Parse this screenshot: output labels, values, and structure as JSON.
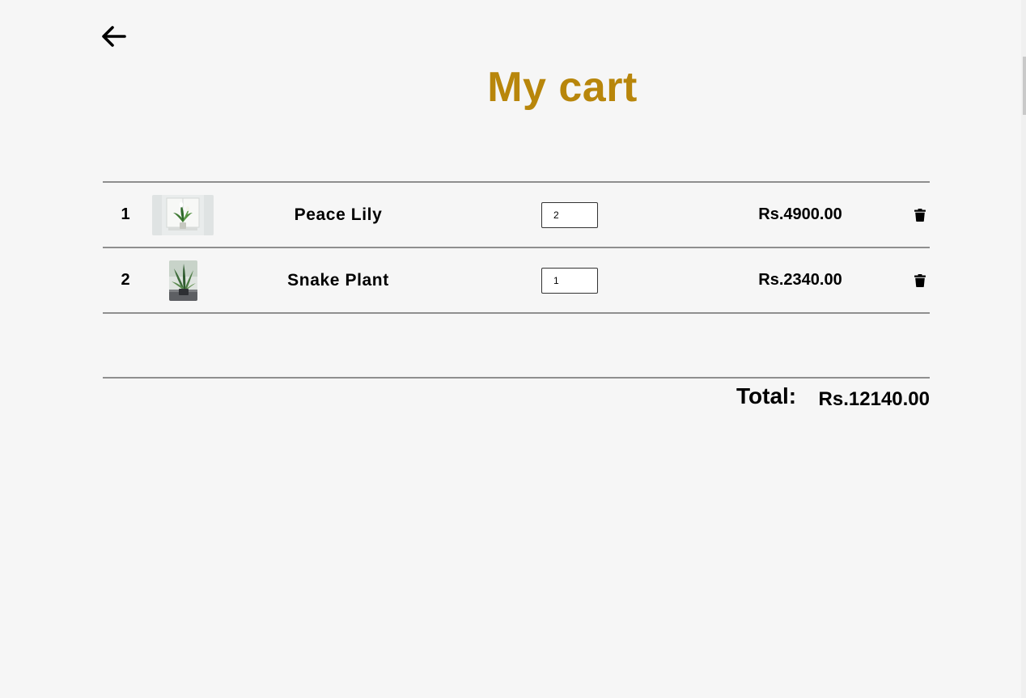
{
  "header": {
    "back_icon": "arrow-left-icon",
    "title": "My cart",
    "title_color": "#b8860b"
  },
  "cart": {
    "items": [
      {
        "index": "1",
        "name": "Peace Lily",
        "quantity": "2",
        "price": "Rs.4900.00",
        "image_icon": "peace-lily-image",
        "delete_icon": "trash-icon"
      },
      {
        "index": "2",
        "name": "Snake Plant",
        "quantity": "1",
        "price": "Rs.2340.00",
        "image_icon": "snake-plant-image",
        "delete_icon": "trash-icon"
      }
    ]
  },
  "summary": {
    "total_label": "Total:",
    "total_value": "Rs.12140.00"
  }
}
